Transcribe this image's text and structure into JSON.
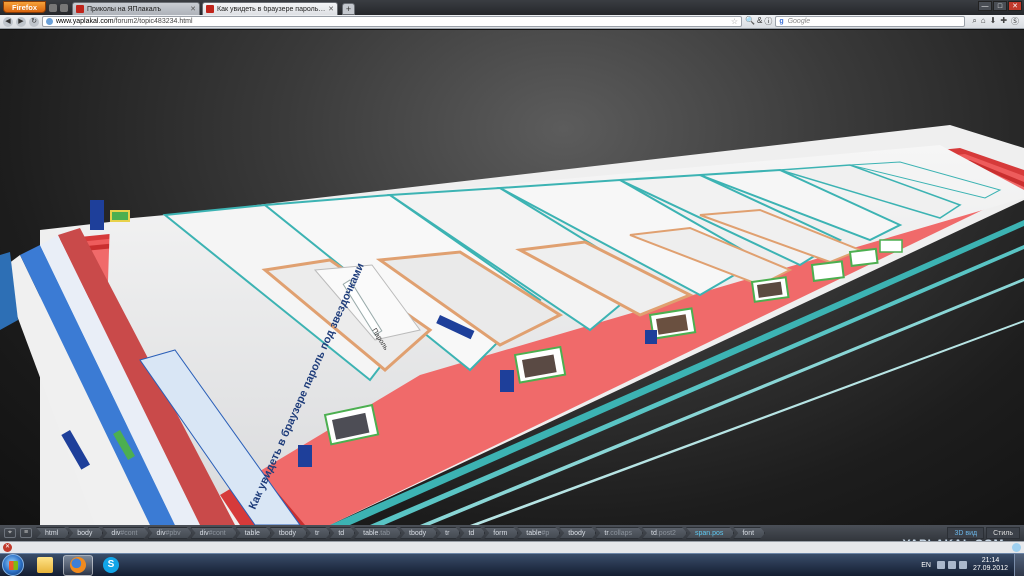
{
  "browser": {
    "app_button_label": "Firefox",
    "tabs": [
      {
        "label": "Приколы на ЯПлакалъ",
        "active": false
      },
      {
        "label": "Как увидеть в браузере пароль под...",
        "active": true
      }
    ],
    "new_tab_label": "+",
    "window_controls": {
      "minimize": "—",
      "maximize": "□",
      "close": "✕"
    }
  },
  "navbar": {
    "url_host": "www.yaplakal.com",
    "url_path": "/forum2/topic483234.html",
    "search_placeholder": "Google",
    "search_engine_glyph": "g"
  },
  "view3d": {
    "page_heading": "Как увидеть в браузере пароль под звездочками",
    "password_label": "Пароль",
    "accent_colors": {
      "red": "#e04545",
      "teal": "#3cb3b3",
      "blue": "#2a5fb8",
      "orange": "#e0a070",
      "white": "#f3f3f3"
    }
  },
  "inspector": {
    "crumbs": [
      {
        "label": "html"
      },
      {
        "label": "body"
      },
      {
        "label": "div",
        "suffix": "#cont"
      },
      {
        "label": "div",
        "suffix": "#pbv"
      },
      {
        "label": "div",
        "suffix": "#cont"
      },
      {
        "label": "table"
      },
      {
        "label": "tbody"
      },
      {
        "label": "tr"
      },
      {
        "label": "td"
      },
      {
        "label": "table",
        "suffix": ".tab"
      },
      {
        "label": "tbody"
      },
      {
        "label": "tr"
      },
      {
        "label": "td"
      },
      {
        "label": "form"
      },
      {
        "label": "table",
        "suffix": "#p"
      },
      {
        "label": "tbody"
      },
      {
        "label": "tr",
        "suffix": ".collaps"
      },
      {
        "label": "td",
        "suffix": ".post2"
      },
      {
        "label": "span",
        "suffix": ".pos",
        "selected": true
      },
      {
        "label": "font"
      }
    ],
    "mode_3d_label": "3D вид",
    "style_label": "Стиль"
  },
  "watermark": "YAPLAKAL.COM",
  "taskbar": {
    "language": "EN",
    "time": "21:14",
    "date": "27.09.2012",
    "apps": [
      {
        "name": "explorer",
        "icon": "folder-icon"
      },
      {
        "name": "firefox",
        "icon": "firefox-icon",
        "active": true
      },
      {
        "name": "skype",
        "icon": "skype-icon",
        "glyph": "S"
      }
    ]
  }
}
